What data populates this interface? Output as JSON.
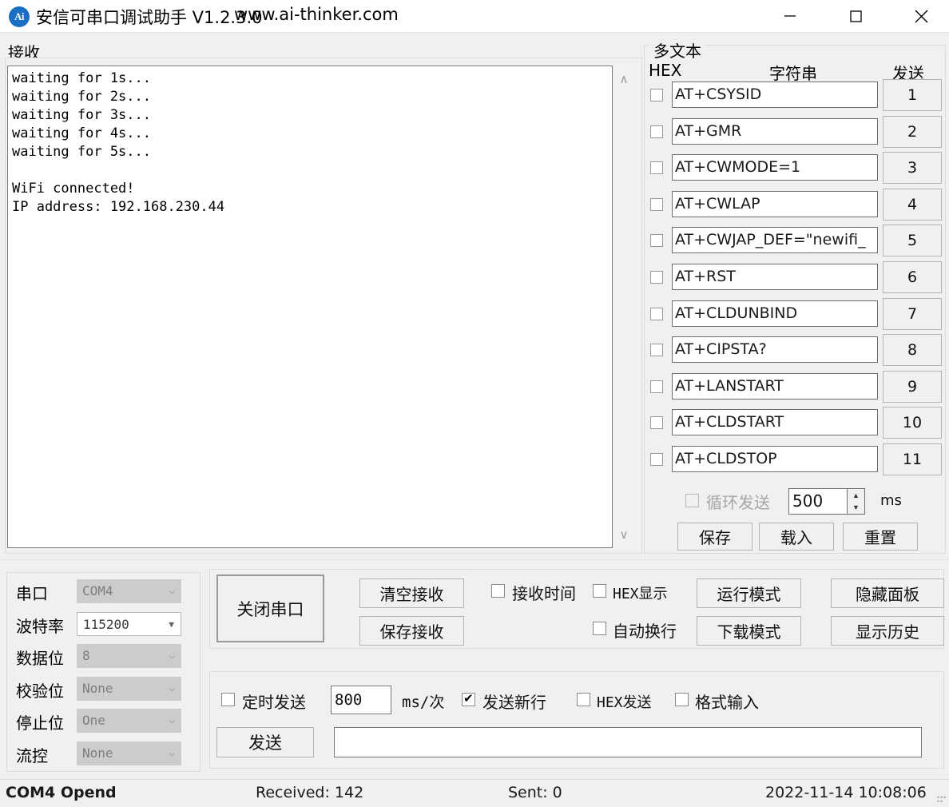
{
  "window": {
    "icon_text": "Ai",
    "title": "安信可串口调试助手 V1.2.3.0",
    "url": "www.ai-thinker.com",
    "minimize_icon": "minimize-icon",
    "maximize_icon": "maximize-icon",
    "close_icon": "close-icon"
  },
  "receive": {
    "label": "接收",
    "content": "waiting for 1s...\nwaiting for 2s...\nwaiting for 3s...\nwaiting for 4s...\nwaiting for 5s...\n\nWiFi connected!\nIP address: 192.168.230.44"
  },
  "multitext": {
    "title": "多文本",
    "header_hex": "HEX",
    "header_string": "字符串",
    "header_send": "发送",
    "rows": [
      {
        "hex": false,
        "command": "AT+CSYSID",
        "send_label": "1"
      },
      {
        "hex": false,
        "command": "AT+GMR",
        "send_label": "2"
      },
      {
        "hex": false,
        "command": "AT+CWMODE=1",
        "send_label": "3"
      },
      {
        "hex": false,
        "command": "AT+CWLAP",
        "send_label": "4"
      },
      {
        "hex": false,
        "command": "AT+CWJAP_DEF=\"newifi_",
        "send_label": "5"
      },
      {
        "hex": false,
        "command": "AT+RST",
        "send_label": "6"
      },
      {
        "hex": false,
        "command": "AT+CLDUNBIND",
        "send_label": "7"
      },
      {
        "hex": false,
        "command": "AT+CIPSTA?",
        "send_label": "8"
      },
      {
        "hex": false,
        "command": "AT+LANSTART",
        "send_label": "9"
      },
      {
        "hex": false,
        "command": "AT+CLDSTART",
        "send_label": "10"
      },
      {
        "hex": false,
        "command": "AT+CLDSTOP",
        "send_label": "11"
      }
    ],
    "loop_send_label": "循环发送",
    "loop_send_checked": false,
    "loop_interval": "500",
    "loop_unit": "ms",
    "save_label": "保存",
    "load_label": "载入",
    "reset_label": "重置"
  },
  "serial": {
    "rows": [
      {
        "label": "串口",
        "value": "COM4",
        "enabled": false
      },
      {
        "label": "波特率",
        "value": "115200",
        "enabled": true
      },
      {
        "label": "数据位",
        "value": "8",
        "enabled": false
      },
      {
        "label": "校验位",
        "value": "None",
        "enabled": false
      },
      {
        "label": "停止位",
        "value": "One",
        "enabled": false
      },
      {
        "label": "流控",
        "value": "None",
        "enabled": false
      }
    ]
  },
  "controls": {
    "close_port": "关闭串口",
    "clear_receive": "清空接收",
    "save_receive": "保存接收",
    "recv_time_label": "接收时间",
    "recv_time_checked": false,
    "hex_display_label": "HEX显示",
    "hex_display_checked": false,
    "auto_wrap_label": "自动换行",
    "auto_wrap_checked": false,
    "run_mode": "运行模式",
    "download_mode": "下载模式",
    "hide_panel": "隐藏面板",
    "show_history": "显示历史"
  },
  "send": {
    "timed_send_label": "定时发送",
    "timed_send_checked": false,
    "interval_value": "800",
    "interval_unit": "ms/次",
    "newline_label": "发送新行",
    "newline_checked": true,
    "hex_send_label": "HEX发送",
    "hex_send_checked": false,
    "format_input_label": "格式输入",
    "format_input_checked": false,
    "send_button": "发送",
    "send_input_value": ""
  },
  "status": {
    "port": "COM4 Opend",
    "received": "Received: 142",
    "sent": "Sent: 0",
    "datetime": "2022-11-14 10:08:06"
  }
}
